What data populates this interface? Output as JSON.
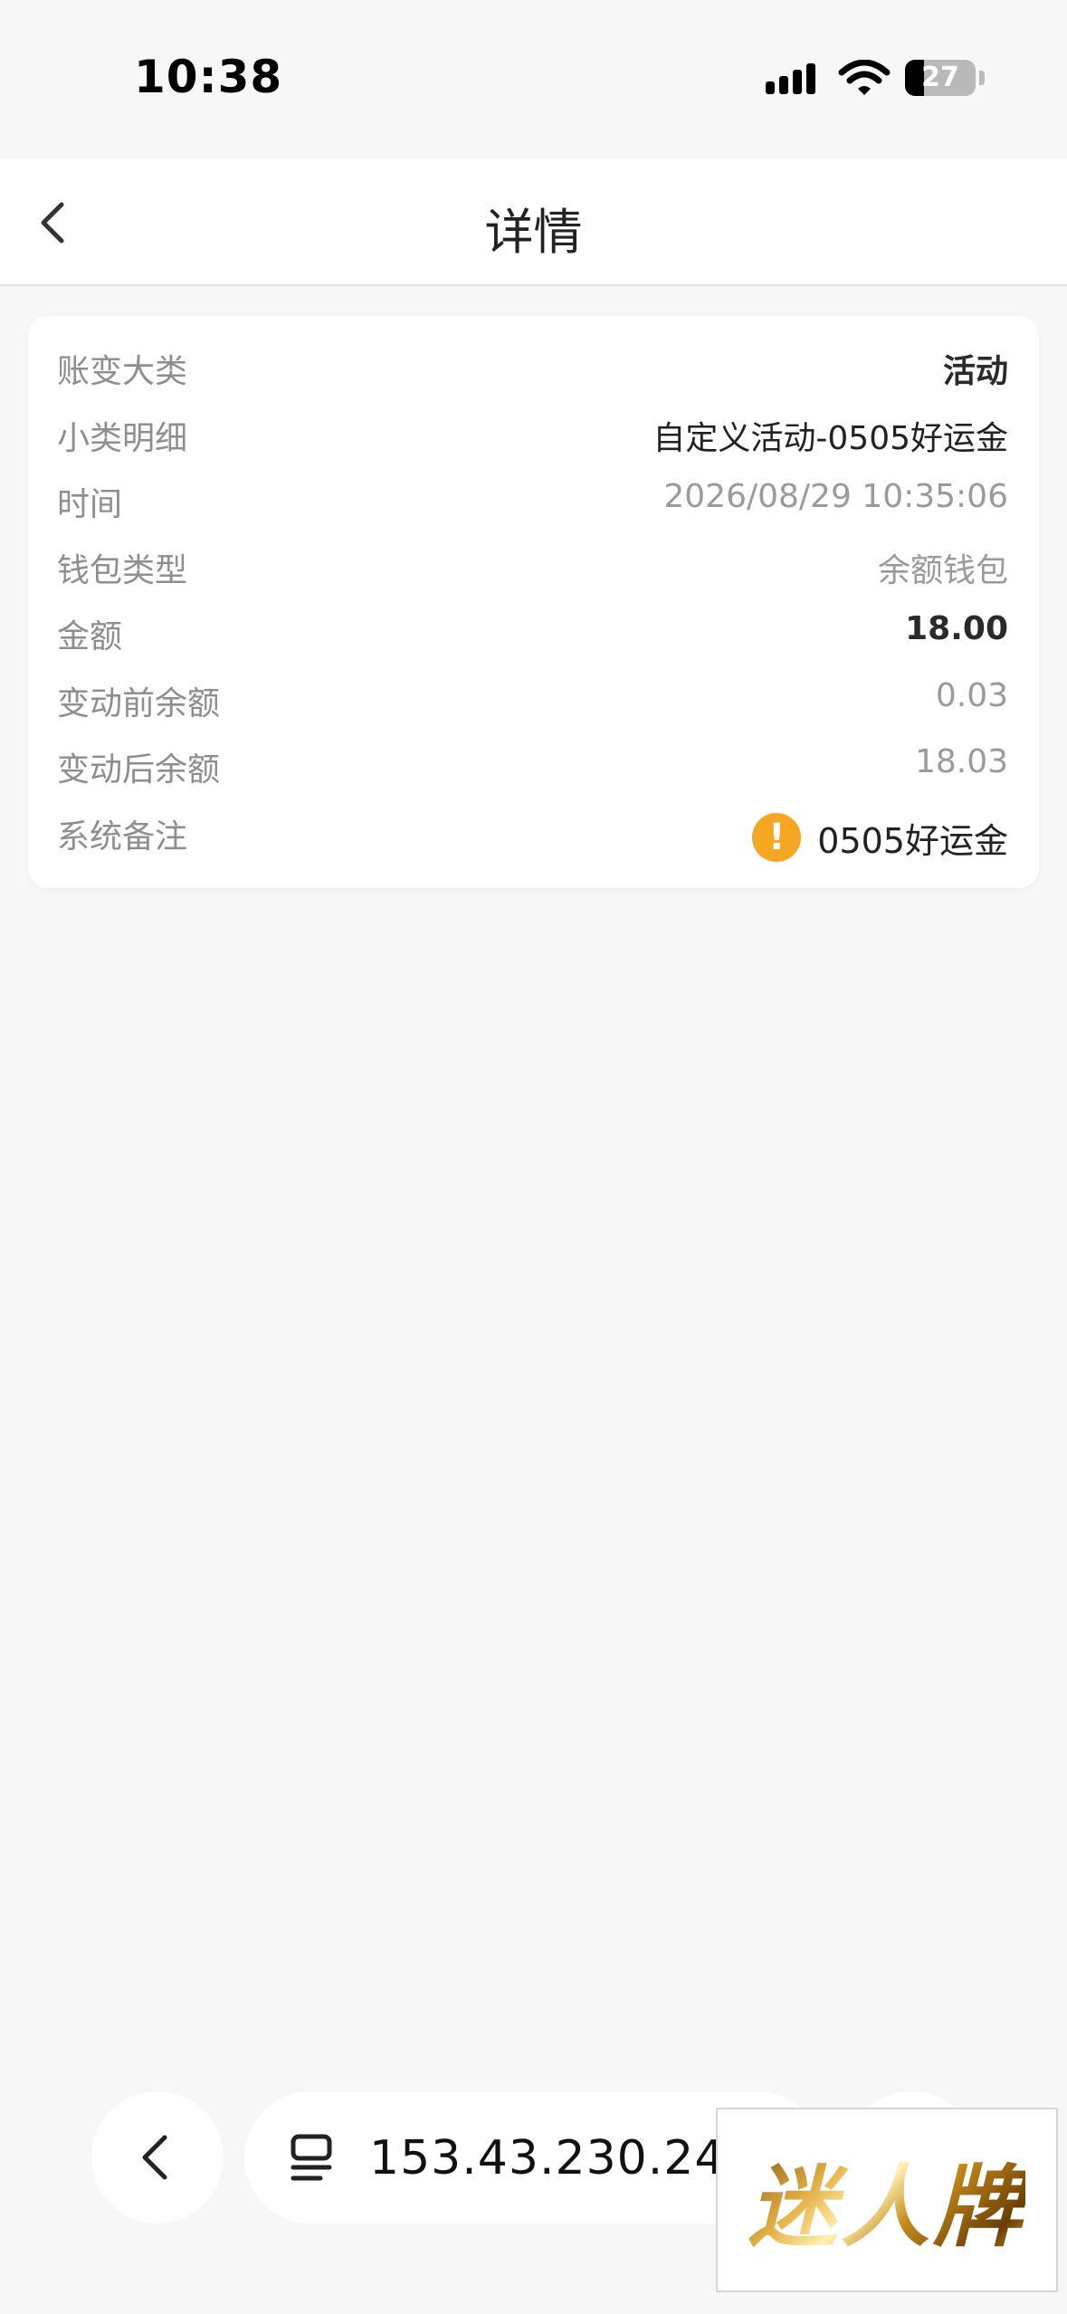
{
  "status_bar": {
    "time": "10:38",
    "battery_level": "27",
    "battery_fraction": 0.27,
    "icons": [
      "signal-icon",
      "wifi-icon",
      "battery-icon"
    ]
  },
  "nav": {
    "title": "详情",
    "back_icon": "chevron-left-icon"
  },
  "details": {
    "rows": [
      {
        "label": "账变大类",
        "value": "活动"
      },
      {
        "label": "小类明细",
        "value": "自定义活动-0505好运金"
      },
      {
        "label": "时间",
        "value": "2026/08/29 10:35:06"
      },
      {
        "label": "钱包类型",
        "value": "余额钱包"
      },
      {
        "label": "金额",
        "value": "18.00"
      },
      {
        "label": "变动前余额",
        "value": "0.03"
      },
      {
        "label": "变动后余额",
        "value": "18.03"
      },
      {
        "label": "系统备注",
        "value": "0505好运金",
        "icon": "warning-icon"
      }
    ]
  },
  "browser_bar": {
    "url": "153.43.230.247",
    "back_icon": "chevron-left-icon",
    "tabs_icon": "tabs-icon"
  },
  "watermark": {
    "text": "迷人牌"
  },
  "colors": {
    "background": "#f7f7f7",
    "card": "#ffffff",
    "label": "#8e8e8e",
    "warning": "#f5a623"
  }
}
